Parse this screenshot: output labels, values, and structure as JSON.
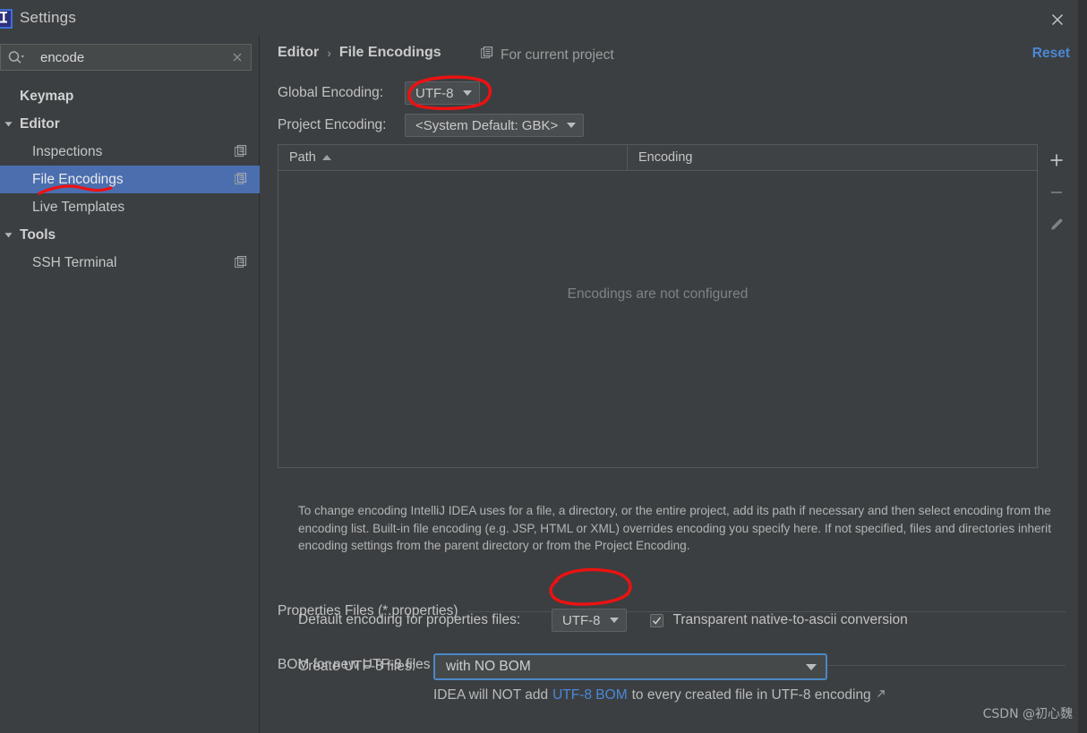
{
  "window": {
    "title": "Settings",
    "app_icon": "intellij-idea-icon",
    "close_icon": "close-icon"
  },
  "sidebar": {
    "search": {
      "value": "encode",
      "placeholder": "",
      "search_icon": "search-icon",
      "clear_icon": "clear-icon"
    },
    "items": [
      {
        "label": "Keymap",
        "level": 0,
        "group": true,
        "arrow": "",
        "selected": false,
        "badge": false
      },
      {
        "label": "Editor",
        "level": 0,
        "group": true,
        "arrow": "▼",
        "selected": false,
        "badge": false
      },
      {
        "label": "Inspections",
        "level": 1,
        "group": false,
        "arrow": "",
        "selected": false,
        "badge": true
      },
      {
        "label": "File Encodings",
        "level": 1,
        "group": false,
        "arrow": "",
        "selected": true,
        "badge": true
      },
      {
        "label": "Live Templates",
        "level": 1,
        "group": false,
        "arrow": "",
        "selected": false,
        "badge": false
      },
      {
        "label": "Tools",
        "level": 0,
        "group": true,
        "arrow": "▼",
        "selected": false,
        "badge": false
      },
      {
        "label": "SSH Terminal",
        "level": 1,
        "group": false,
        "arrow": "",
        "selected": false,
        "badge": true
      }
    ]
  },
  "content": {
    "breadcrumb": {
      "parent": "Editor",
      "separator": "›",
      "current": "File Encodings"
    },
    "for_current_project": {
      "label": "For current project",
      "icon": "project-scope-icon"
    },
    "reset_label": "Reset",
    "global_encoding": {
      "label": "Global Encoding:",
      "value": "UTF-8"
    },
    "project_encoding": {
      "label": "Project Encoding:",
      "value": "<System Default: GBK>"
    },
    "table": {
      "columns": [
        "Path",
        "Encoding"
      ],
      "sort_column": "Path",
      "sort_direction": "ascending",
      "rows": [],
      "empty_message": "Encodings are not configured",
      "tools": [
        {
          "name": "add-button",
          "glyph": "+"
        },
        {
          "name": "remove-button",
          "glyph": "−"
        },
        {
          "name": "edit-button",
          "glyph": "pencil"
        }
      ]
    },
    "help_text": "To change encoding IntelliJ IDEA uses for a file, a directory, or the entire project, add its path if necessary and then select encoding from the encoding list. Built-in file encoding (e.g. JSP, HTML or XML) overrides encoding you specify here. If not specified, files and directories inherit encoding settings from the parent directory or from the Project Encoding.",
    "properties_section": {
      "title": "Properties Files (*.properties)",
      "default_encoding_label": "Default encoding for properties files:",
      "default_encoding_value": "UTF-8",
      "transparent_label": "Transparent native-to-ascii conversion",
      "transparent_checked": true
    },
    "bom_section": {
      "title": "BOM for new UTF-8 files",
      "create_label": "Create UTF-8 files:",
      "create_value": "with NO BOM",
      "note_prefix": "IDEA will NOT add ",
      "note_link": "UTF-8 BOM",
      "note_suffix": " to every created file in UTF-8 encoding",
      "note_external_icon": "external-link-icon"
    }
  },
  "watermark": "CSDN @初心魏",
  "annotations": {
    "color": "#ee1111",
    "marks": [
      {
        "name": "annotation-circle-global-encoding",
        "type": "ellipse"
      },
      {
        "name": "annotation-underline-file-encodings",
        "type": "underline"
      },
      {
        "name": "annotation-circle-properties-encoding",
        "type": "ellipse"
      }
    ]
  },
  "colors": {
    "window_bg": "#3c3f41",
    "selection_blue": "#4b6eaf",
    "link_blue": "#4a88d6",
    "focus_blue": "#4a88c7",
    "annotation_red": "#ee1111"
  }
}
